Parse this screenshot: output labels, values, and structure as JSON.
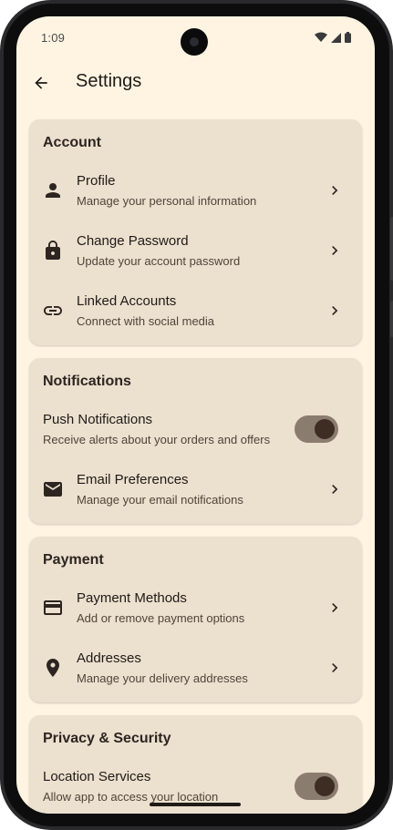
{
  "status_bar": {
    "time": "1:09"
  },
  "header": {
    "title": "Settings"
  },
  "sections": [
    {
      "title": "Account",
      "items": [
        {
          "type": "link",
          "icon": "person-icon",
          "title": "Profile",
          "subtitle": "Manage your personal information"
        },
        {
          "type": "link",
          "icon": "lock-icon",
          "title": "Change Password",
          "subtitle": "Update your account password"
        },
        {
          "type": "link",
          "icon": "link-icon",
          "title": "Linked Accounts",
          "subtitle": "Connect with social media"
        }
      ]
    },
    {
      "title": "Notifications",
      "items": [
        {
          "type": "toggle",
          "title": "Push Notifications",
          "subtitle": "Receive alerts about your orders and offers",
          "on": true
        },
        {
          "type": "link",
          "icon": "mail-icon",
          "title": "Email Preferences",
          "subtitle": "Manage your email notifications"
        }
      ]
    },
    {
      "title": "Payment",
      "items": [
        {
          "type": "link",
          "icon": "credit-card-icon",
          "title": "Payment Methods",
          "subtitle": "Add or remove payment options"
        },
        {
          "type": "link",
          "icon": "location-pin-icon",
          "title": "Addresses",
          "subtitle": "Manage your delivery addresses"
        }
      ]
    },
    {
      "title": "Privacy & Security",
      "items": [
        {
          "type": "toggle",
          "title": "Location Services",
          "subtitle": "Allow app to access your location",
          "on": true
        }
      ]
    }
  ],
  "colors": {
    "background": "#fff4e2",
    "card": "#ece0cf",
    "switch_track": "#8a7c6e",
    "switch_thumb": "#3e2d22"
  }
}
